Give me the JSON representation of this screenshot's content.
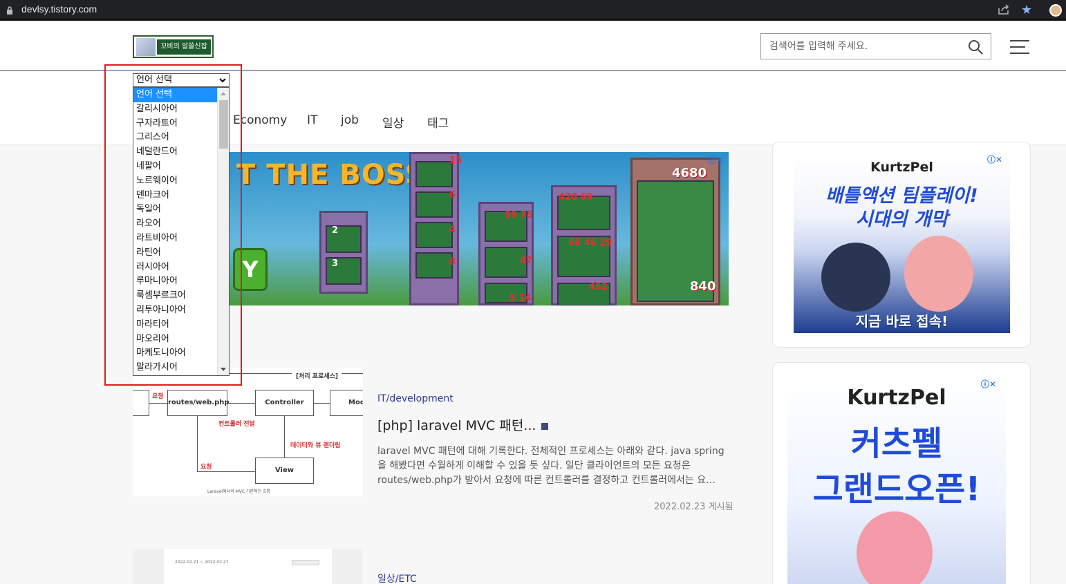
{
  "browser": {
    "url": "devlsy.tistory.com"
  },
  "header": {
    "logo_text": "꼬비의 알쓸신잡",
    "search_placeholder": "검색어를 입력해 주세요."
  },
  "nav": {
    "items": [
      "Economy",
      "IT",
      "job",
      "일상",
      "태그"
    ]
  },
  "language_selector": {
    "selected": "언어 선택",
    "options": [
      "언어 선택",
      "갈리시아어",
      "구자라트어",
      "그리스어",
      "네덜란드어",
      "네팔어",
      "노르웨이어",
      "덴마크어",
      "독일어",
      "라오어",
      "라트비아어",
      "라틴어",
      "러시아어",
      "루마니아어",
      "룩셈부르크어",
      "리투아니아어",
      "마라티어",
      "마오리어",
      "마케도니아어",
      "말라가시어"
    ]
  },
  "ad_banner": {
    "headline": "T THE BOSS!",
    "button_text": "Y",
    "numbers": [
      "15",
      "6",
      "4",
      "8",
      "99 75",
      "47",
      "5 14",
      "420 69",
      "68 46 29",
      "452",
      "4680",
      "840",
      "2",
      "3"
    ]
  },
  "post1": {
    "category": "IT/development",
    "title": "[php] laravel MVC 패턴...",
    "body": "laravel MVC 패턴에 대해 기록한다. 전체적인 프로세스는 아래와 같다. java spring을 해봤다면 수월하게 이해할 수 있을 듯 싶다. 일단 클라이언트의 모든 요청은 routes/web.php가 받아서 요청에 따른 컨트롤러를 결정하고 컨트롤러에서는 요…",
    "date": "2022.02.23 게시됨",
    "diagram": {
      "group_label": "[처리 프로세스]",
      "routes": "routes/web.php",
      "controller": "Controller",
      "model": "Mod",
      "view": "View",
      "req1": "요청",
      "req2": "요청",
      "to_controller": "컨트롤러 전달",
      "render": "데이터와 뷰 렌더링",
      "caption": "Laravel에서의 MVC 기본적인 흐름"
    }
  },
  "post2": {
    "category": "일상/ETC",
    "thumb_date": "2022.02.21 ~ 2022.02.27"
  },
  "side_ads": [
    {
      "logo": "KurtzPel",
      "line1": "배틀액션 팀플레이!",
      "line2": "시대의 개막",
      "cta": "지금 바로 접속!"
    },
    {
      "logo": "KurtzPel",
      "line1": "커츠펠",
      "line2": "그랜드오픈!"
    }
  ],
  "colors": {
    "accent": "#2b3a8c",
    "highlight": "#e21b1b",
    "selected_option": "#1e90ff"
  }
}
